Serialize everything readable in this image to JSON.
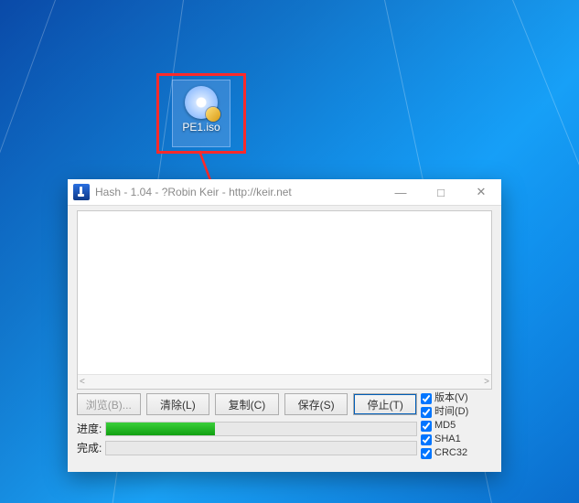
{
  "desktop_icon": {
    "label": "PE1.iso"
  },
  "annotation": {
    "box1": true,
    "box2": true,
    "arrow": true,
    "color": "#ff2a2a"
  },
  "window": {
    "title": "Hash - 1.04 - ?Robin Keir - http://keir.net",
    "controls": {
      "min": "—",
      "max": "□",
      "close": "✕"
    },
    "text_area": "",
    "buttons": {
      "browse": "浏览(B)...",
      "clear": "清除(L)",
      "copy": "复制(C)",
      "save": "保存(S)",
      "stop": "停止(T)"
    },
    "checkboxes": {
      "version": {
        "label": "版本(V)",
        "checked": true
      },
      "date": {
        "label": "时间(D)",
        "checked": true
      },
      "md5": {
        "label": "MD5",
        "checked": true
      },
      "sha1": {
        "label": "SHA1",
        "checked": true
      },
      "crc32": {
        "label": "CRC32",
        "checked": true
      }
    },
    "progress": {
      "current_label": "进度:",
      "current_pct": 35,
      "total_label": "完成:",
      "total_pct": 0
    }
  }
}
